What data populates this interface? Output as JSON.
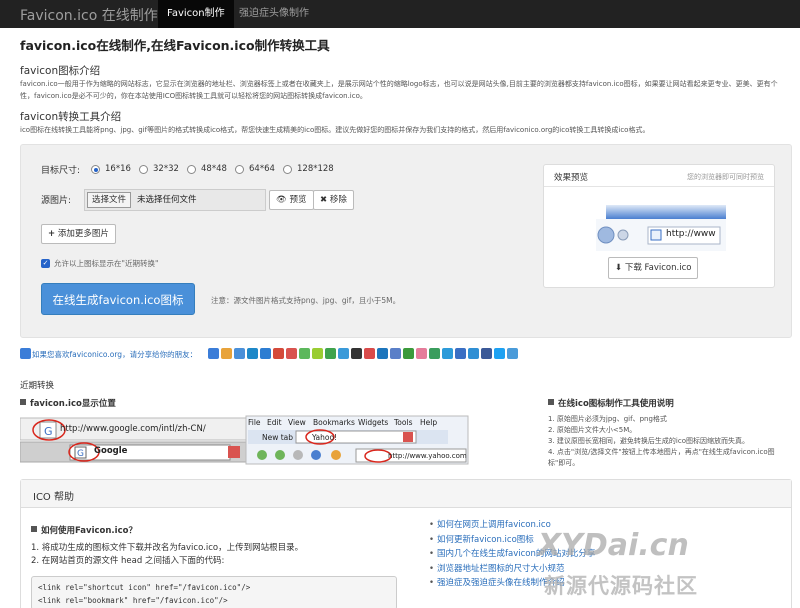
{
  "navbar": {
    "brand": "Favicon.ico 在线制作",
    "tabs": [
      {
        "label": "Favicon制作",
        "active": true
      },
      {
        "label": "强迫症头像制作",
        "active": false
      }
    ]
  },
  "page_title": "favicon.ico在线制作,在线Favicon.ico制作转换工具",
  "intro": {
    "heading": "favicon图标介绍",
    "text": "favicon.ico一般用于作为缩略的网站标志，它显示在浏览器的地址栏、浏览器标签上或者在收藏夹上，是展示网站个性的缩略logo标志，也可以说是网站头像,目前主要的浏览器都支持favicon.ico图标，如果要让网站看起来更专业、更美、更有个性，favicon.ico是必不可少的，你在本站使用ICO图标转换工具就可以轻松将您的网站图标转换成favicon.ico。"
  },
  "tool_intro": {
    "heading": "favicon转换工具介绍",
    "text": "ico图标在线转换工具能将png、jpg、gif等图片的格式转换成ico格式，帮您快速生成精美的ico图标。建议先做好您的图标并保存为我们支持的格式，然后用faviconico.org的ico转换工具转换成ico格式。"
  },
  "form": {
    "size_label": "目标尺寸:",
    "sizes": [
      "16*16",
      "32*32",
      "48*48",
      "64*64",
      "128*128"
    ],
    "selected_size": "16*16",
    "source_label": "源图片:",
    "file_button": "选择文件",
    "file_status": "未选择任何文件",
    "preview_button": "预览",
    "remove_button": "移除",
    "add_more_button": "添加更多图片",
    "recent_checkbox": "允许以上图标显示在\"近期转换\"",
    "recent_checked": true,
    "generate_button": "在线生成favicon.ico图标",
    "note": "注意：源文件图片格式支持png、jpg、gif，且小于5M。"
  },
  "preview_panel": {
    "title": "效果预览",
    "note": "您的浏览器即可同时预览",
    "url_text": "http://www",
    "download_button": "下载 Favicon.ico"
  },
  "share": {
    "text": "如果您喜欢faviconico.org，请分享给你的朋友：",
    "colors": [
      "#3b7dd8",
      "#e8a33a",
      "#4a90d9",
      "#1e88c8",
      "#2d7dd2",
      "#d44a3a",
      "#d9534f",
      "#5cb85c",
      "#9acd32",
      "#3fa34d",
      "#3a9ad9",
      "#333",
      "#d94a4a",
      "#1c75bc",
      "#5a7fc8",
      "#3b9a3b",
      "#e57c9a",
      "#3a9d5d",
      "#2d9bd9",
      "#3a6fc4",
      "#2f8fd4",
      "#3b5998",
      "#1da1f2",
      "#4a9bd9"
    ]
  },
  "recent": {
    "label": "近期转换",
    "position_heading": "favicon.ico显示位置",
    "tips_heading": "在线ico图标制作工具使用说明",
    "tips": [
      "1. 原始图片必须为jpg、gif、png格式",
      "2. 原始图片文件大小<5M。",
      "3. 建议原图长宽相同，避免转换后生成的ico图标因缩放而失真。",
      "4. 点击\"浏览/选择文件\"按钮上传本地图片，再点\"在线生成favicon.ico图标\"即可。"
    ]
  },
  "screens": {
    "url_google": "http://www.google.com/intl/zh-CN/",
    "google_tab": "Google",
    "menu": [
      "File",
      "Edit",
      "View",
      "Bookmarks",
      "Widgets",
      "Tools",
      "Help"
    ],
    "new_tab": "New tab",
    "yahoo_tab": "Yahoo!",
    "url_yahoo": "http://www.yahoo.com"
  },
  "help": {
    "title": "ICO 帮助",
    "question": "如何使用Favicon.ico？",
    "steps": [
      "1. 将成功生成的图标文件下载并改名为favico.ico，上传到网站根目录。",
      "2. 在网站首页的源文件 head 之间插入下面的代码:"
    ],
    "code": [
      "<link rel=\"shortcut icon\" href=\"/favicon.ico\"/>",
      "<link rel=\"bookmark\" href=\"/favicon.ico\"/>"
    ],
    "links": [
      "如何在网页上调用favicon.ico",
      "如何更新favicon.ico图标",
      "国内几个在线生成favicon的网站对比分享",
      "浏览器地址栏图标的尺寸大小规范",
      "强迫症及强迫症头像在线制作介绍"
    ]
  },
  "watermark": {
    "line1": "XYDai.cn",
    "line2": "新源代源码社区"
  }
}
